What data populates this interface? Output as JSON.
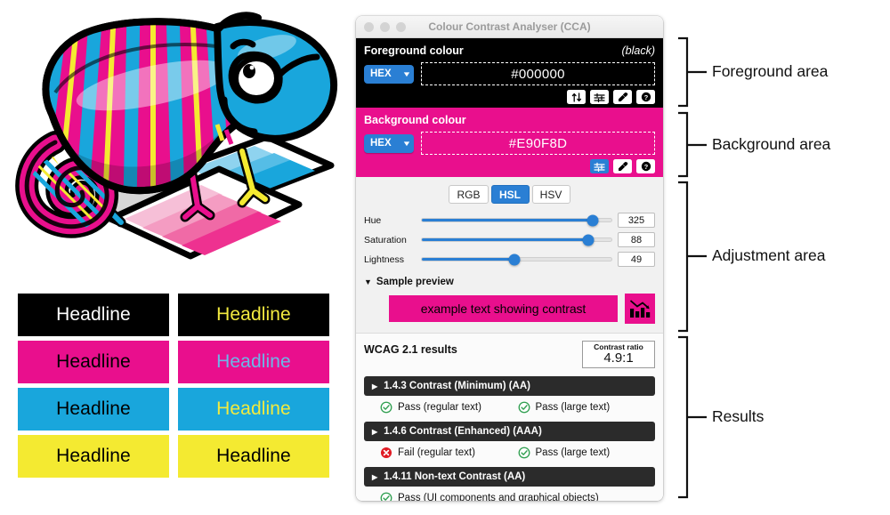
{
  "window": {
    "title": "Colour Contrast Analyser (CCA)",
    "traffic_lights": [
      "close-button",
      "minimize-button",
      "zoom-button"
    ]
  },
  "foreground": {
    "title": "Foreground colour",
    "note": "(black)",
    "format_label": "HEX",
    "value": "#000000",
    "bg_color": "#000000",
    "text_color": "#ffffff",
    "icons": [
      "swap-colours-icon",
      "sliders-icon",
      "eyedropper-icon",
      "help-icon"
    ]
  },
  "background": {
    "title": "Background colour",
    "format_label": "HEX",
    "value": "#E90F8D",
    "bg_color": "#E90F8D",
    "text_color": "#ffffff",
    "icons": [
      "sliders-icon",
      "eyedropper-icon",
      "help-icon"
    ]
  },
  "adjustment": {
    "modes": [
      "RGB",
      "HSL",
      "HSV"
    ],
    "active_mode": "HSL",
    "accent_color": "#2a7fd4",
    "sliders": [
      {
        "label": "Hue",
        "value": "325",
        "percent": 90
      },
      {
        "label": "Saturation",
        "value": "88",
        "percent": 88
      },
      {
        "label": "Lightness",
        "value": "49",
        "percent": 49
      }
    ]
  },
  "sample": {
    "heading": "Sample preview",
    "disclosure": "▼",
    "text": "example text showing contrast",
    "swatch_bg": "#E90F8D",
    "swatch_fg": "#000000",
    "chart_icon": "bar-chart-declining-icon"
  },
  "results": {
    "title": "WCAG 2.1 results",
    "ratio_label": "Contrast ratio",
    "ratio_value": "4.9:1",
    "criteria": [
      {
        "name": "1.4.3 Contrast (Minimum) (AA)",
        "disclosure": "▶",
        "verdicts": [
          {
            "status": "pass",
            "text": "Pass (regular text)"
          },
          {
            "status": "pass",
            "text": "Pass (large text)"
          }
        ]
      },
      {
        "name": "1.4.6 Contrast (Enhanced) (AAA)",
        "disclosure": "▶",
        "verdicts": [
          {
            "status": "fail",
            "text": "Fail (regular text)"
          },
          {
            "status": "pass",
            "text": "Pass (large text)"
          }
        ]
      },
      {
        "name": "1.4.11 Non-text Contrast (AA)",
        "disclosure": "▶",
        "verdicts": [
          {
            "status": "pass",
            "text": "Pass (UI components and graphical objects)"
          }
        ]
      }
    ],
    "pass_color": "#2e9e4f",
    "fail_color": "#e01b24"
  },
  "annotations": [
    {
      "label": "Foreground area"
    },
    {
      "label": "Background area"
    },
    {
      "label": "Adjustment area"
    },
    {
      "label": "Results"
    }
  ],
  "swatches": [
    {
      "text": "Headline",
      "bg": "#000000",
      "fg": "#ffffff"
    },
    {
      "text": "Headline",
      "bg": "#000000",
      "fg": "#f2ea3f"
    },
    {
      "text": "Headline",
      "bg": "#E90F8D",
      "fg": "#000000"
    },
    {
      "text": "Headline",
      "bg": "#E90F8D",
      "fg": "#6cb7e8"
    },
    {
      "text": "Headline",
      "bg": "#19A6DC",
      "fg": "#000000"
    },
    {
      "text": "Headline",
      "bg": "#19A6DC",
      "fg": "#f2ea3f"
    },
    {
      "text": "Headline",
      "bg": "#F4EA31",
      "fg": "#000000"
    },
    {
      "text": "Headline",
      "bg": "#F4EA31",
      "fg": "#000000"
    }
  ],
  "illustration": {
    "name": "chameleon-colour-swatches-illustration",
    "colors": {
      "magenta": "#E90F8D",
      "cyan": "#19A6DC",
      "yellow": "#F4EA31",
      "outline": "#000000",
      "shadow": "#d7d7d7"
    },
    "swatch_card_tints": [
      "#F6BFD7",
      "#F49CC2",
      "#F06AA6",
      "#EE3190",
      "#E90F8D"
    ],
    "card_blue_tints": [
      "#8FD3EF",
      "#55BDE6",
      "#19A6DC"
    ]
  }
}
